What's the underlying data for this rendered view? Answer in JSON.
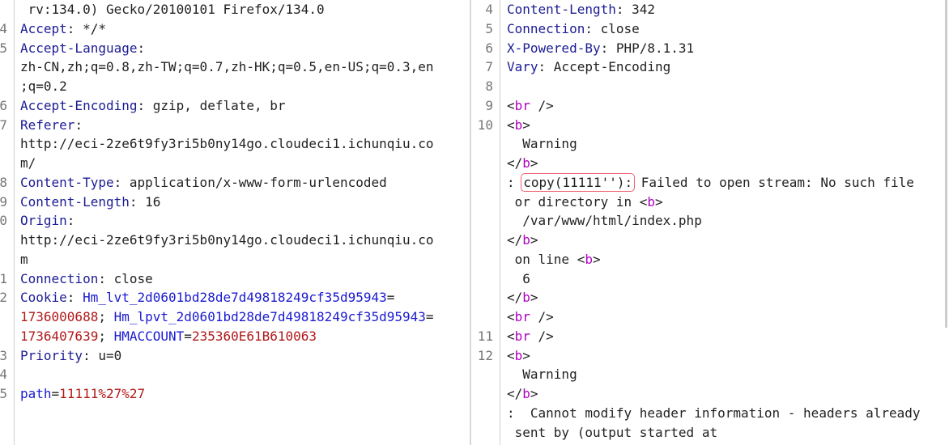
{
  "request": {
    "rows": [
      {
        "n": "",
        "segs": [
          [
            " rv:134.0) Gecko/20100101 Firefox/134.0",
            "v"
          ]
        ]
      },
      {
        "n": "4",
        "segs": [
          [
            "Accept",
            "k"
          ],
          [
            ": */*",
            "v"
          ]
        ]
      },
      {
        "n": "5",
        "segs": [
          [
            "Accept-Language",
            "k"
          ],
          [
            ":",
            "v"
          ]
        ]
      },
      {
        "n": "",
        "segs": [
          [
            "zh-CN,zh;q=0.8,zh-TW;q=0.7,zh-HK;q=0.5,en-US;q=0.3,en",
            "v"
          ]
        ]
      },
      {
        "n": "",
        "segs": [
          [
            ";q=0.2",
            "v"
          ]
        ]
      },
      {
        "n": "6",
        "segs": [
          [
            "Accept-Encoding",
            "k"
          ],
          [
            ": gzip, deflate, br",
            "v"
          ]
        ]
      },
      {
        "n": "7",
        "segs": [
          [
            "Referer",
            "k"
          ],
          [
            ":",
            "v"
          ]
        ]
      },
      {
        "n": "",
        "segs": [
          [
            "http://eci-2ze6t9fy3ri5b0ny14go.cloudeci1.ichunqiu.co",
            "v"
          ]
        ]
      },
      {
        "n": "",
        "segs": [
          [
            "m/",
            "v"
          ]
        ]
      },
      {
        "n": "8",
        "segs": [
          [
            "Content-Type",
            "k"
          ],
          [
            ": application/x-www-form-urlencoded",
            "v"
          ]
        ]
      },
      {
        "n": "9",
        "segs": [
          [
            "Content-Length",
            "k"
          ],
          [
            ": 16",
            "v"
          ]
        ]
      },
      {
        "n": "0",
        "segs": [
          [
            "Origin",
            "k"
          ],
          [
            ":",
            "v"
          ]
        ]
      },
      {
        "n": "",
        "segs": [
          [
            "http://eci-2ze6t9fy3ri5b0ny14go.cloudeci1.ichunqiu.co",
            "v"
          ]
        ]
      },
      {
        "n": "",
        "segs": [
          [
            "m",
            "v"
          ]
        ]
      },
      {
        "n": "1",
        "segs": [
          [
            "Connection",
            "k"
          ],
          [
            ": close",
            "v"
          ]
        ]
      },
      {
        "n": "2",
        "segs": [
          [
            "Cookie",
            "k"
          ],
          [
            ": ",
            "v"
          ],
          [
            "Hm_lvt_2d0601bd28de7d49818249cf35d95943",
            "b"
          ],
          [
            "=",
            "v"
          ]
        ]
      },
      {
        "n": "",
        "segs": [
          [
            "1736000688",
            "r"
          ],
          [
            "; ",
            "v"
          ],
          [
            "Hm_lpvt_2d0601bd28de7d49818249cf35d95943",
            "b"
          ],
          [
            "=",
            "v"
          ]
        ]
      },
      {
        "n": "",
        "segs": [
          [
            "1736407639",
            "r"
          ],
          [
            "; ",
            "v"
          ],
          [
            "HMACCOUNT",
            "b"
          ],
          [
            "=",
            "v"
          ],
          [
            "235360E61B610063",
            "r"
          ]
        ]
      },
      {
        "n": "3",
        "segs": [
          [
            "Priority",
            "k"
          ],
          [
            ": u=0",
            "v"
          ]
        ]
      },
      {
        "n": "4",
        "segs": []
      },
      {
        "n": "5",
        "segs": [
          [
            "path",
            "b"
          ],
          [
            "=",
            "v"
          ],
          [
            "11111%27%27",
            "r"
          ]
        ]
      }
    ]
  },
  "response": {
    "rows": [
      {
        "n": "4",
        "segs": [
          [
            "Content-Length",
            "k"
          ],
          [
            ": 342",
            "v"
          ]
        ]
      },
      {
        "n": "5",
        "segs": [
          [
            "Connection",
            "k"
          ],
          [
            ": close",
            "v"
          ]
        ]
      },
      {
        "n": "6",
        "segs": [
          [
            "X-Powered-By",
            "k"
          ],
          [
            ": PHP/8.1.31",
            "v"
          ]
        ]
      },
      {
        "n": "7",
        "segs": [
          [
            "Vary",
            "k"
          ],
          [
            ": Accept-Encoding",
            "v"
          ]
        ]
      },
      {
        "n": "8",
        "segs": []
      },
      {
        "n": "9",
        "segs": [
          [
            "<",
            "v"
          ],
          [
            "br",
            "t"
          ],
          [
            " />",
            "v"
          ]
        ]
      },
      {
        "n": "10",
        "segs": [
          [
            "<",
            "v"
          ],
          [
            "b",
            "t"
          ],
          [
            ">",
            "v"
          ]
        ]
      },
      {
        "n": "",
        "segs": [
          [
            "  Warning",
            "v"
          ]
        ]
      },
      {
        "n": "",
        "segs": [
          [
            "</",
            "v"
          ],
          [
            "b",
            "t"
          ],
          [
            ">",
            "v"
          ]
        ]
      },
      {
        "n": "",
        "segs": [
          [
            ": ",
            "v"
          ],
          [
            "copy(11111''):",
            "hl"
          ],
          [
            " Failed to open stream: No such file",
            "v"
          ]
        ]
      },
      {
        "n": "",
        "segs": [
          [
            " or directory in <",
            "v"
          ],
          [
            "b",
            "t"
          ],
          [
            ">",
            "v"
          ]
        ]
      },
      {
        "n": "",
        "segs": [
          [
            "  /var/www/html/index.php",
            "v"
          ]
        ]
      },
      {
        "n": "",
        "segs": [
          [
            "</",
            "v"
          ],
          [
            "b",
            "t"
          ],
          [
            ">",
            "v"
          ]
        ]
      },
      {
        "n": "",
        "segs": [
          [
            " on line <",
            "v"
          ],
          [
            "b",
            "t"
          ],
          [
            ">",
            "v"
          ]
        ]
      },
      {
        "n": "",
        "segs": [
          [
            "  6",
            "v"
          ]
        ]
      },
      {
        "n": "",
        "segs": [
          [
            "</",
            "v"
          ],
          [
            "b",
            "t"
          ],
          [
            ">",
            "v"
          ]
        ]
      },
      {
        "n": "",
        "segs": [
          [
            "<",
            "v"
          ],
          [
            "br",
            "t"
          ],
          [
            " />",
            "v"
          ]
        ]
      },
      {
        "n": "11",
        "segs": [
          [
            "<",
            "v"
          ],
          [
            "br",
            "t"
          ],
          [
            " />",
            "v"
          ]
        ]
      },
      {
        "n": "12",
        "segs": [
          [
            "<",
            "v"
          ],
          [
            "b",
            "t"
          ],
          [
            ">",
            "v"
          ]
        ]
      },
      {
        "n": "",
        "segs": [
          [
            "  Warning",
            "v"
          ]
        ]
      },
      {
        "n": "",
        "segs": [
          [
            "</",
            "v"
          ],
          [
            "b",
            "t"
          ],
          [
            ">",
            "v"
          ]
        ]
      },
      {
        "n": "",
        "segs": [
          [
            ":  Cannot modify header information - headers already",
            "v"
          ]
        ]
      },
      {
        "n": "",
        "segs": [
          [
            " sent by (output started at",
            "v"
          ]
        ]
      }
    ]
  }
}
